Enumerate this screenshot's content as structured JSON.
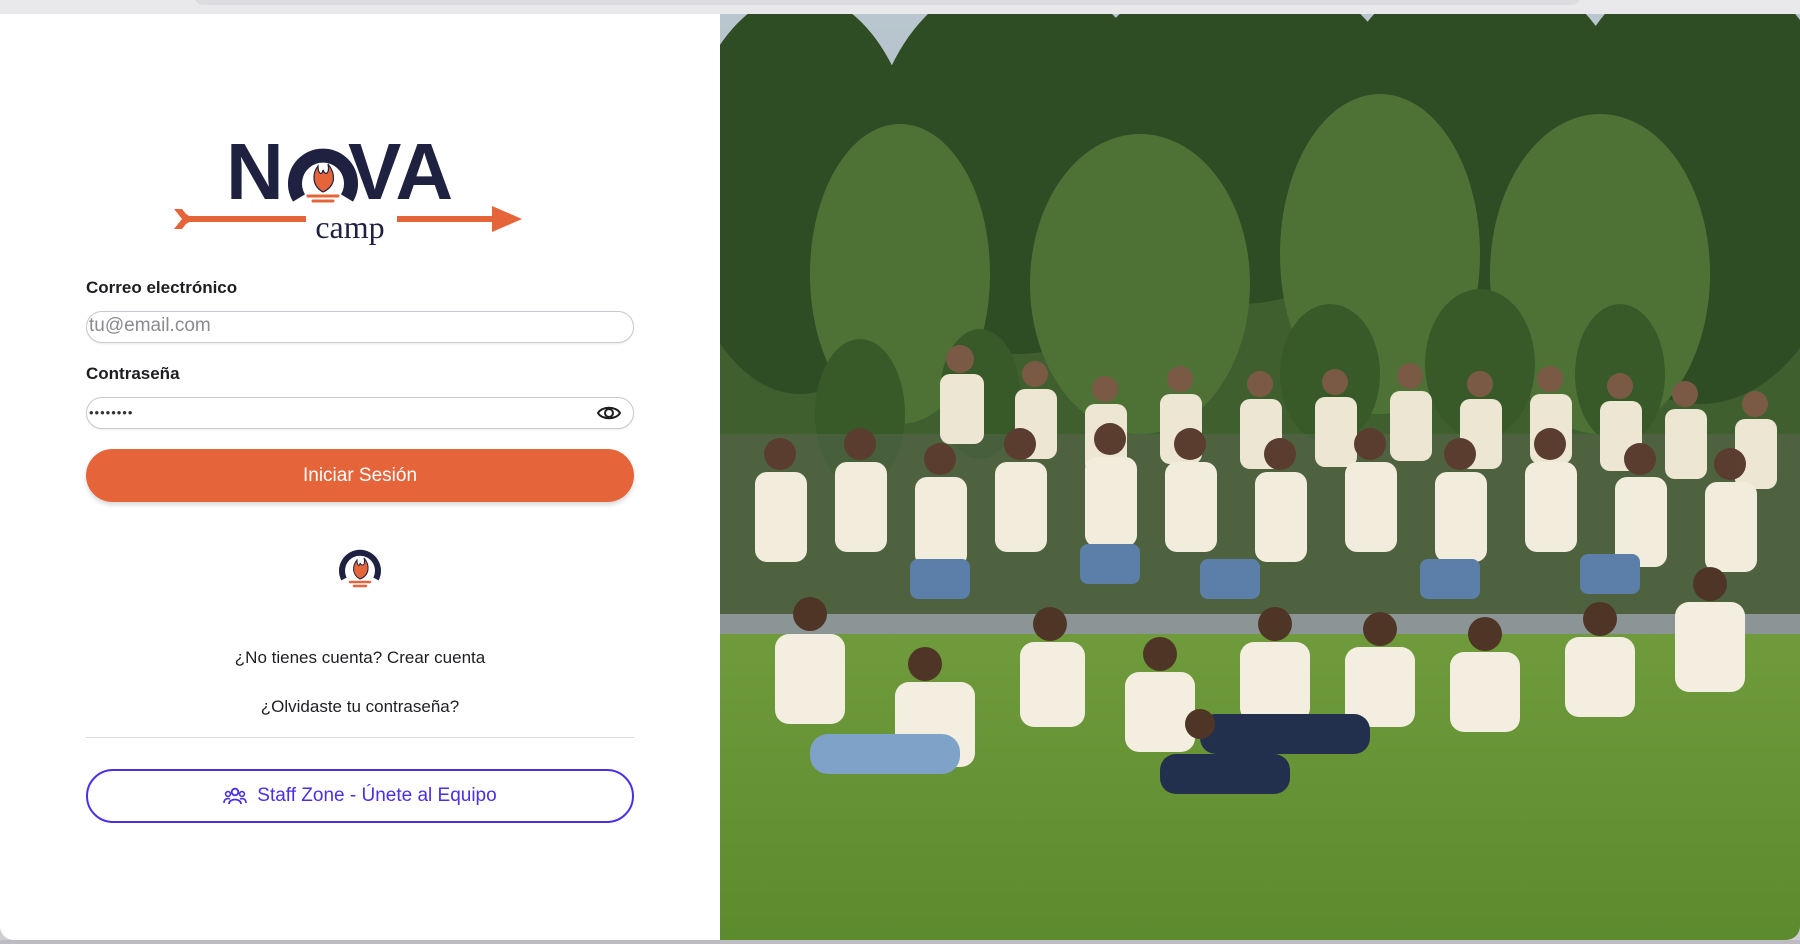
{
  "browser": {},
  "logo": {
    "word_left": "N",
    "word_right": "VA",
    "sub": "camp"
  },
  "form": {
    "email_label": "Correo electrónico",
    "email_placeholder": "tu@email.com",
    "email_value": "",
    "password_label": "Contraseña",
    "password_value": "••••••••",
    "password_toggle_icon": "eye-icon",
    "submit_label": "Iniciar Sesión"
  },
  "links": {
    "create_account": "¿No tienes cuenta? Crear cuenta",
    "forgot_password": "¿Olvidaste tu contraseña?"
  },
  "staff": {
    "icon": "users-icon",
    "label": "Staff Zone - Únete al Equipo"
  },
  "colors": {
    "brand_navy": "#1f2140",
    "brand_orange": "#e6643a",
    "staff_purple": "#4b2ee6"
  },
  "hero_image": {
    "icon": "group-photo-image"
  }
}
